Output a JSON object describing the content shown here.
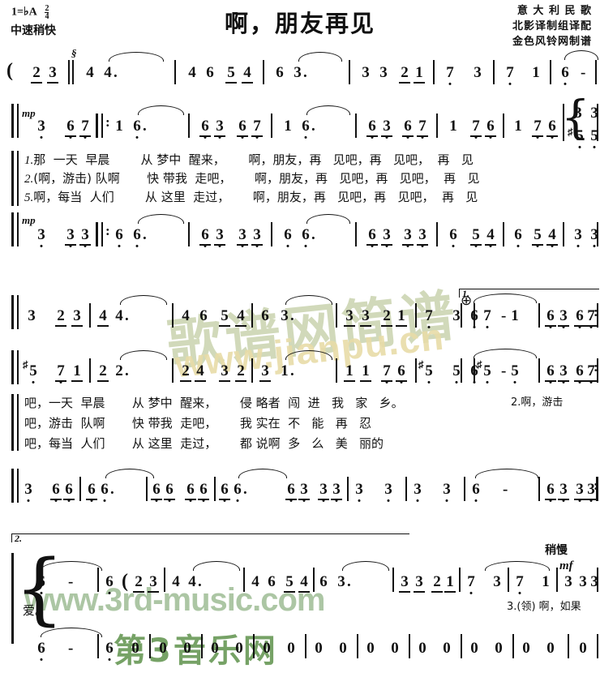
{
  "header": {
    "key_label": "1=",
    "key_value": "♭A",
    "time_top": "2",
    "time_bottom": "4",
    "tempo": "中速稍快",
    "title": "啊，朋友再见",
    "credits": [
      "意 大 利 民 歌",
      "北影译制组译配",
      "金色风铃网制谱"
    ]
  },
  "watermarks": {
    "w1": "歌谱网简谱",
    "w2": "www.jianpu.cn",
    "w3": "www.3rd-music.com",
    "w4": "第3音乐网"
  },
  "dynamics": {
    "mp": "mp",
    "mf": "mf"
  },
  "marks": {
    "slower": "稍慢",
    "segno": "§",
    "coda": "⊕",
    "ending_1": "1.",
    "ending_2": "2.",
    "sharp": "♯"
  },
  "systems": [
    {
      "name": "intro",
      "notes": [
        "2",
        "3",
        "4",
        "4.",
        "4",
        "6",
        "5",
        "4",
        "6",
        "3.",
        "3",
        "3",
        "2",
        "1",
        "7",
        "3",
        "7",
        "1",
        "6",
        "–",
        "6"
      ]
    },
    {
      "name": "verse-upper-1",
      "notes": [
        "3",
        "6",
        "7",
        "1",
        "6.",
        "6",
        "3",
        "6",
        "7",
        "1",
        "6.",
        "6",
        "3",
        "6",
        "7",
        "1",
        "7",
        "6",
        "1",
        "7",
        "6",
        "3",
        "3"
      ]
    },
    {
      "name": "verse-lower-1",
      "notes": [
        "3",
        "3",
        "3",
        "6",
        "6.",
        "6",
        "3",
        "3",
        "3",
        "6",
        "6.",
        "6",
        "3",
        "3",
        "3",
        "6",
        "5",
        "4",
        "6",
        "5",
        "4",
        "3",
        "3"
      ]
    },
    {
      "name": "verse-upper-2",
      "notes": [
        "3",
        "2",
        "3",
        "4",
        "4.",
        "4",
        "6",
        "5",
        "4",
        "6",
        "3.",
        "3",
        "3",
        "2",
        "1",
        "7",
        "3",
        "7",
        "1",
        "6",
        "–",
        "6",
        "3",
        "6",
        "7"
      ]
    },
    {
      "name": "verse-lower-2",
      "notes": [
        "5",
        "7",
        "1",
        "2",
        "2.",
        "2",
        "4",
        "3",
        "2",
        "3",
        "1.",
        "1",
        "1",
        "1",
        "7",
        "6",
        "5",
        "5",
        "5",
        "5",
        "6",
        "–",
        "6",
        "3",
        "6",
        "7"
      ]
    },
    {
      "name": "verse-lower-3",
      "notes": [
        "3",
        "6",
        "6",
        "6",
        "6.",
        "6",
        "6",
        "6",
        "6",
        "6",
        "6.",
        "6",
        "3",
        "3",
        "3",
        "3",
        "3",
        "3",
        "3",
        "6",
        "–",
        "6",
        "3",
        "3",
        "3"
      ]
    },
    {
      "name": "ending2-upper",
      "notes": [
        "6",
        "–",
        "6",
        "2",
        "3",
        "4",
        "4.",
        "4",
        "6",
        "5",
        "4",
        "6",
        "3.",
        "3",
        "3",
        "2",
        "1",
        "7",
        "3",
        "7",
        "1",
        "6",
        "0",
        "6",
        "3",
        "3",
        "3"
      ]
    },
    {
      "name": "ending2-lower",
      "notes": [
        "6",
        "–",
        "6",
        "6",
        "0",
        "0",
        "0",
        "0",
        "0",
        "0",
        "0",
        "0",
        "0",
        "0",
        "0",
        "0",
        "0",
        "0",
        "0",
        "0",
        "0",
        "0",
        "0",
        "0",
        "0"
      ]
    }
  ],
  "lyrics": {
    "block1": [
      {
        "num": "1.",
        "text": "那  一天  早晨        从 梦中  醒来，      啊，朋友，再   见吧，再   见吧，  再   见"
      },
      {
        "num": "2.",
        "text": "(啊，游击) 队啊       快 带我  走吧，      啊，朋友，再   见吧，再   见吧，  再   见"
      },
      {
        "num": "5.",
        "text": "啊，每当  人们        从 这里  走过，      啊，朋友，再   见吧，再   见吧，  再   见"
      }
    ],
    "block2": [
      {
        "num": "",
        "text": "吧，一天  早晨       从 梦中  醒来，      侵 略者  闯  进   我   家   乡。"
      },
      {
        "num": "",
        "text": "吧，游击  队啊       快 带我  走吧，      我 实在  不   能   再   忍"
      },
      {
        "num": "",
        "text": "吧，每当  人们       从 这里  走过，      都 说啊  多   么   美   丽的"
      }
    ],
    "cue_verse2": "2.啊，游击",
    "cue_verse3": "3.(领) 啊，如果",
    "tail": "爱。"
  }
}
